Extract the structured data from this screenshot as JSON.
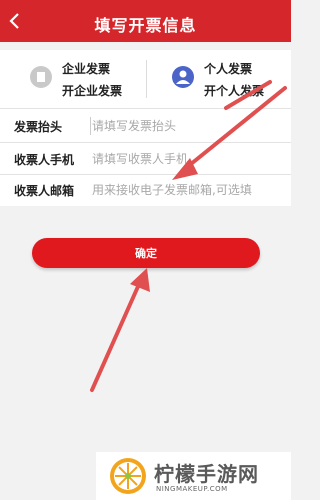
{
  "header": {
    "title": "填写开票信息"
  },
  "invoice_type": {
    "company": {
      "label": "企业发票",
      "sub": "开企业发票"
    },
    "personal": {
      "label": "个人发票",
      "sub": "开个人发票"
    }
  },
  "form": {
    "rows": [
      {
        "label": "发票抬头",
        "placeholder": "请填写发票抬头"
      },
      {
        "label": "收票人手机",
        "placeholder": "请填写收票人手机"
      },
      {
        "label": "收票人邮箱",
        "placeholder": "用来接收电子发票邮箱,可选填"
      }
    ]
  },
  "confirm_label": "确定",
  "watermark": {
    "name": "柠檬手游网",
    "url": "NINGMAKEUP.COM"
  },
  "colors": {
    "header": "#d5272b",
    "button": "#e0191f",
    "person_icon": "#4a64c8",
    "arrow": "#e05050"
  }
}
